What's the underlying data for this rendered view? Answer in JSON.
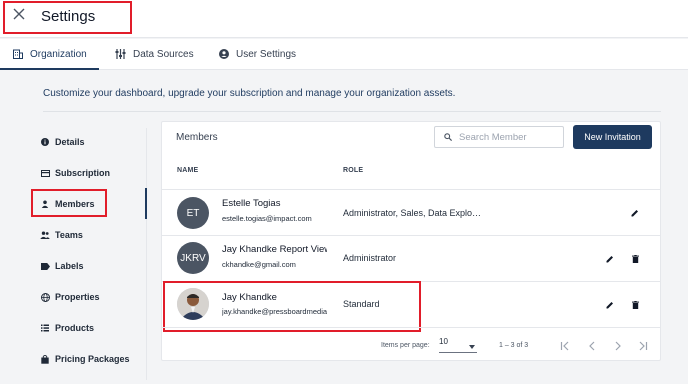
{
  "header": {
    "title": "Settings"
  },
  "tabs": [
    {
      "label": "Organization",
      "icon": "building-icon",
      "active": true
    },
    {
      "label": "Data Sources",
      "icon": "data-sources-icon",
      "active": false
    },
    {
      "label": "User Settings",
      "icon": "user-circle-icon",
      "active": false
    }
  ],
  "intro": "Customize your dashboard, upgrade your subscription and manage your organization assets.",
  "sidebar": {
    "items": [
      {
        "label": "Details",
        "icon": "info-icon"
      },
      {
        "label": "Subscription",
        "icon": "card-icon"
      },
      {
        "label": "Members",
        "icon": "person-icon",
        "active": true
      },
      {
        "label": "Teams",
        "icon": "group-icon"
      },
      {
        "label": "Labels",
        "icon": "label-icon"
      },
      {
        "label": "Properties",
        "icon": "globe-icon"
      },
      {
        "label": "Products",
        "icon": "list-icon"
      },
      {
        "label": "Pricing Packages",
        "icon": "bag-icon"
      }
    ]
  },
  "members": {
    "title": "Members",
    "search_placeholder": "Search Member",
    "new_button": "New Invitation",
    "columns": {
      "name": "NAME",
      "role": "ROLE"
    },
    "rows": [
      {
        "initials": "ET",
        "name": "Estelle Togias",
        "email": "estelle.togias@impact.com",
        "role": "Administrator, Sales, Data Explo…",
        "can_delete": false
      },
      {
        "initials": "JKRV",
        "name": "Jay Khandke Report Viewer",
        "email": "ckhandke@gmail.com",
        "role": "Administrator",
        "can_delete": true
      },
      {
        "initials": "",
        "name": "Jay Khandke",
        "email": "jay.khandke@pressboardmedia.com",
        "role": "Standard",
        "can_delete": true,
        "photo": true
      }
    ],
    "pagination": {
      "items_per_page_label": "Items per page:",
      "items_per_page": "10",
      "range": "1 – 3 of 3"
    }
  },
  "colors": {
    "accent": "#1e3a5f",
    "highlight": "#e11d2a"
  }
}
